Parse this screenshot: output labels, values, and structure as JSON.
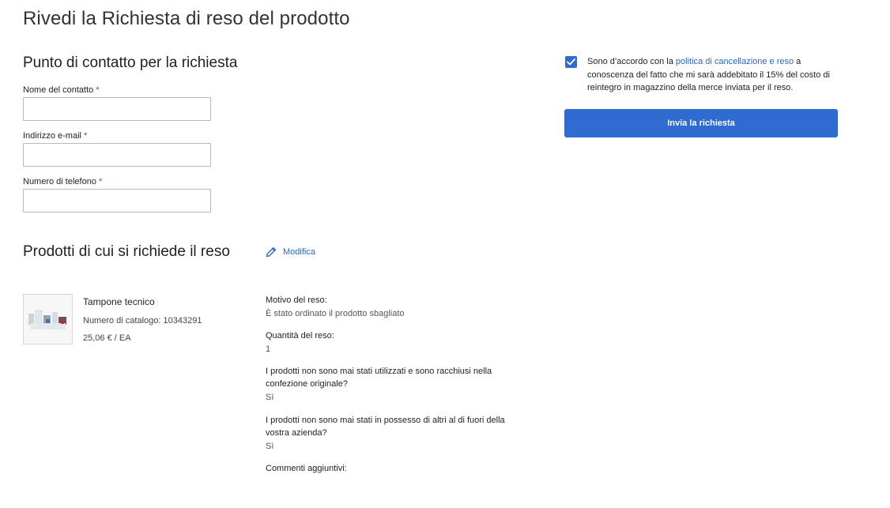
{
  "page": {
    "title": "Rivedi la Richiesta di reso del prodotto"
  },
  "contact": {
    "title": "Punto di contatto per la richiesta",
    "required_marker": "*",
    "fields": [
      {
        "label": "Nome del contatto",
        "value": "",
        "placeholder": ""
      },
      {
        "label": "Indirizzo e-mail",
        "value": "",
        "placeholder": ""
      },
      {
        "label": "Numero di telefono",
        "value": "",
        "placeholder": ""
      }
    ]
  },
  "consent": {
    "checked": true,
    "text_before": "Sono d’accordo con la ",
    "link_text": "politica di cancellazione e reso",
    "text_after": " a conoscenza del fatto che mi sarà addebitato il 15% del costo di reintegro in magazzino della merce inviata per il reso.",
    "submit_label": "Invia la richiesta"
  },
  "products": {
    "title": "Prodotti di cui si richiede il reso",
    "edit_label": "Modifica",
    "item": {
      "name": "Tampone tecnico",
      "catalog": "Numero di catalogo: 10343291",
      "price": "25,06 € / EA"
    },
    "details": {
      "reason_label": "Motivo del reso:",
      "reason_value": "È stato ordinato il prodotto sbagliato",
      "qty_label": "Quantità del reso:",
      "qty_value": "1",
      "unused_label": "I prodotti non sono mai stati utilizzati e sono racchiusi nella confezione originale?",
      "unused_value": "Sì",
      "possession_label": "I prodotti non sono mai stati in possesso di altri al di fuori della vostra azienda?",
      "possession_value": "Sì",
      "comments_label": "Commenti aggiuntivi:"
    }
  },
  "colors": {
    "accent": "#2f6bd1",
    "link": "#2b68c3",
    "required": "#c0392b"
  },
  "icons": {
    "edit": "pencil-icon",
    "check": "checkmark-icon"
  }
}
